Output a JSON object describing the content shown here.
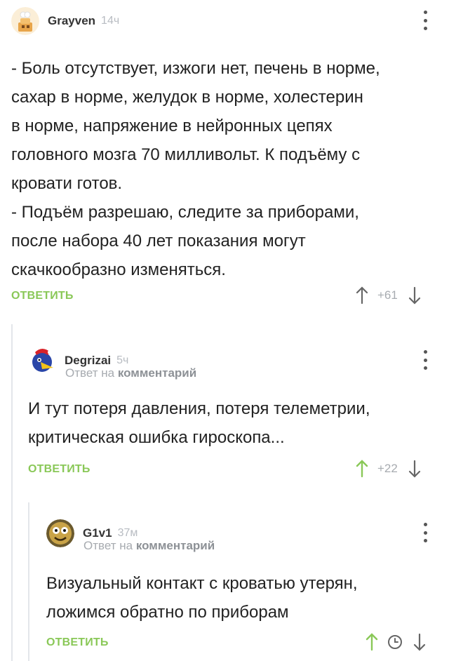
{
  "comments": [
    {
      "author": "Grayven",
      "time": "14ч",
      "lines": [
        "- Боль отсутствует, изжоги нет, печень в норме,",
        "сахар в норме, желудок в норме, холестерин",
        "в норме, напряжение в нейронных цепях",
        "головного мозга 70 милливольт. К подъёму с",
        "кровати готов.",
        "- Подъём разрешаю, следите за приборами,",
        "после набора 40 лет показания могут",
        "скачкообразно изменяться."
      ],
      "answer_label": "ОТВЕТИТЬ",
      "rating": "+61"
    },
    {
      "author": "Degrizai",
      "time": "5ч",
      "reply_prefix": "Ответ на",
      "reply_target": "комментарий",
      "lines": [
        "И тут потеря давления, потеря телеметрии,",
        "критическая ошибка гироскопа..."
      ],
      "answer_label": "ОТВЕТИТЬ",
      "rating": "+22"
    },
    {
      "author": "G1v1",
      "time": "37м",
      "reply_prefix": "Ответ на",
      "reply_target": "комментарий",
      "lines": [
        "Визуальный контакт с кроватью утерян,",
        "ложимся обратно по приборам"
      ],
      "answer_label": "ОТВЕТИТЬ",
      "rating_icon": "clock-icon"
    }
  ],
  "colors": {
    "accent": "#8ac858",
    "muted": "#a7abb0",
    "thread_line": "#e3e6ea"
  }
}
